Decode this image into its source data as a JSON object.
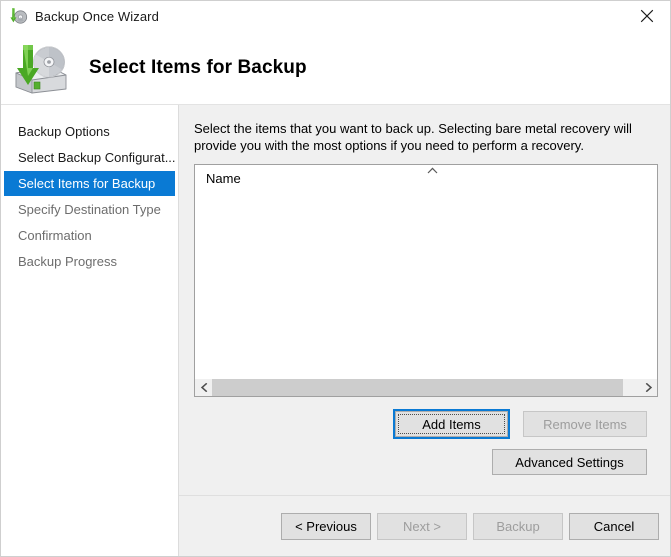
{
  "window": {
    "title": "Backup Once Wizard",
    "titlebar_icon": "backup-disk-icon",
    "close_icon": "close-icon"
  },
  "header": {
    "title": "Select Items for Backup",
    "icon": "backup-drive-disc-icon"
  },
  "sidebar": {
    "items": [
      {
        "label": "Backup Options",
        "state": "done"
      },
      {
        "label": "Select Backup Configurat...",
        "state": "done"
      },
      {
        "label": "Select Items for Backup",
        "state": "active"
      },
      {
        "label": "Specify Destination Type",
        "state": "upcoming"
      },
      {
        "label": "Confirmation",
        "state": "upcoming"
      },
      {
        "label": "Backup Progress",
        "state": "upcoming"
      }
    ]
  },
  "main": {
    "instructions": "Select the items that you want to back up. Selecting bare metal recovery will provide you with the most options if you need to perform a recovery.",
    "list": {
      "column_header": "Name",
      "sort_indicator_icon": "chevron-up-icon",
      "rows": [],
      "scrollbar": {
        "left_arrow_icon": "chevron-left-icon",
        "right_arrow_icon": "chevron-right-icon"
      }
    },
    "buttons": {
      "add_items": {
        "label": "Add Items",
        "enabled": true,
        "focused": true
      },
      "remove_items": {
        "label": "Remove Items",
        "enabled": false
      },
      "advanced_settings": {
        "label": "Advanced Settings",
        "enabled": true
      }
    }
  },
  "footer": {
    "previous": {
      "label": "< Previous",
      "enabled": true
    },
    "next": {
      "label": "Next >",
      "enabled": false
    },
    "backup": {
      "label": "Backup",
      "enabled": false
    },
    "cancel": {
      "label": "Cancel",
      "enabled": true
    }
  },
  "colors": {
    "accent": "#0a7ad4",
    "content_bg": "#f0f0f0",
    "sidebar_bg": "#ffffff",
    "button_face": "#e1e1e1",
    "disabled_text": "#9d9d9d"
  }
}
